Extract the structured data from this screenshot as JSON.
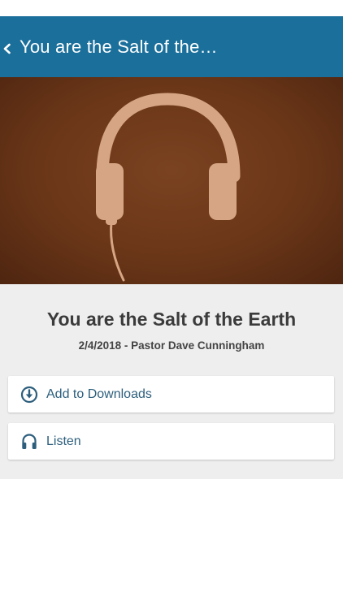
{
  "nav": {
    "title": "You are the Salt of the…",
    "back_icon": "chevron-left-icon"
  },
  "hero": {
    "image": "headphones-artwork"
  },
  "sermon": {
    "title": "You are the Salt of the Earth",
    "meta": "2/4/2018 - Pastor Dave Cunningham"
  },
  "actions": [
    {
      "label": "Add to Downloads",
      "icon": "download-icon"
    },
    {
      "label": "Listen",
      "icon": "headphones-icon"
    }
  ],
  "colors": {
    "nav_bar": "#1b6f9b",
    "accent_text": "#2d5f7d",
    "content_bg": "#eeeeee",
    "hero_bg": "#6a3618",
    "headphones": "#d6a584"
  }
}
